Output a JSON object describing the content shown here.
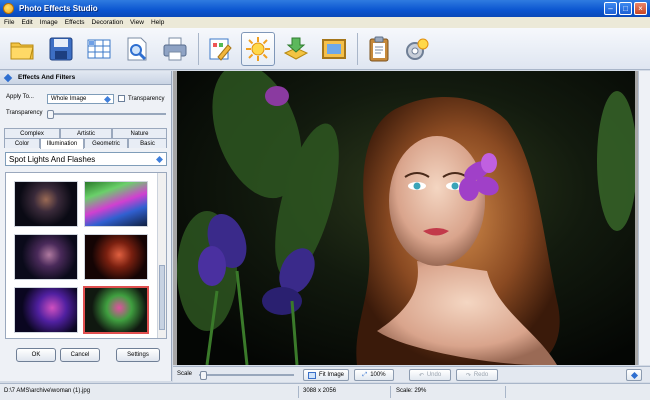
{
  "window": {
    "title": "Photo Effects Studio"
  },
  "menu": [
    "File",
    "Edit",
    "Image",
    "Effects",
    "Decoration",
    "View",
    "Help"
  ],
  "toolbar": {
    "buttons": [
      "open-icon",
      "save-icon",
      "grid-icon",
      "preview-icon",
      "print-icon",
      "edit-icon",
      "effects-icon",
      "download-icon",
      "frame-icon",
      "clipboard-icon",
      "settings-icon"
    ],
    "active": "effects-icon"
  },
  "panel": {
    "title": "Effects And Filters",
    "apply_to_label": "Apply To...",
    "apply_to_value": "Whole Image",
    "transparency_check_label": "Transparency",
    "transparency_label": "Transparency",
    "tabs_top": [
      "Complex",
      "Artistic",
      "Nature"
    ],
    "tabs_bottom": [
      "Color",
      "Illumination",
      "Geometric",
      "Basic"
    ],
    "active_tab": "Illumination",
    "category": "Spot Lights And Flashes",
    "ok": "OK",
    "cancel": "Cancel",
    "settings": "Settings"
  },
  "bottom": {
    "scale_label": "Scale",
    "fit_image": "Fit Image",
    "zoom": "100%",
    "undo": "Undo",
    "redo": "Redo"
  },
  "status": {
    "path": "D:\\7 AMS\\archive\\woman (1).jpg",
    "dimensions": "3088 x 2056",
    "scale": "Scale: 29%"
  },
  "colors": {
    "titlebar": "#0b55d0",
    "accent": "#2f6fd0",
    "selection": "#e05050"
  }
}
